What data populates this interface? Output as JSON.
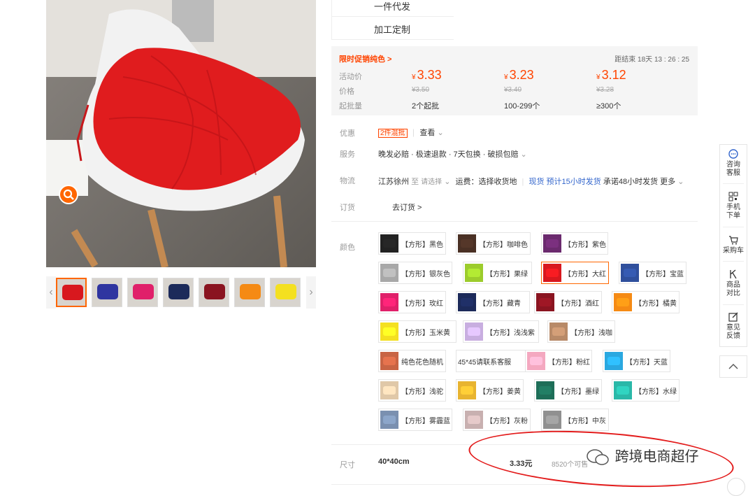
{
  "options": [
    "一件代发",
    "加工定制"
  ],
  "promo": {
    "tag": "限时促销纯色 >",
    "countdown": "距结束 18天 13 : 26 : 25",
    "labels": {
      "price": "活动价",
      "orig": "价格",
      "moq": "起批量"
    },
    "currency": "¥",
    "tiers": [
      {
        "price": "3.33",
        "orig": "¥3.50",
        "qty": "2个起批"
      },
      {
        "price": "3.23",
        "orig": "¥3.40",
        "qty": "100-299个"
      },
      {
        "price": "3.12",
        "orig": "¥3.28",
        "qty": "≥300个"
      }
    ]
  },
  "discount": {
    "label": "优惠",
    "badge": "2件混批",
    "view": "查看"
  },
  "service": {
    "label": "服务",
    "text": "晚发必赔 · 极速退款 · 7天包换 · 破损包赔"
  },
  "logistics": {
    "label": "物流",
    "from": "江苏徐州",
    "to": "至",
    "select": "请选择",
    "fee": "运费：选择收货地",
    "stock": "现货",
    "ship": "预计15小时发货",
    "promise": "承诺48小时发货",
    "more": "更多"
  },
  "order": {
    "label": "订货",
    "link": "去订货 >"
  },
  "color": {
    "label": "颜色",
    "options": [
      {
        "name": "【方形】黑色",
        "c": "#222222"
      },
      {
        "name": "【方形】咖啡色",
        "c": "#4a3024"
      },
      {
        "name": "【方形】紫色",
        "c": "#6b2a6e"
      },
      {
        "name": "【方形】银灰色",
        "c": "#a8a8a8"
      },
      {
        "name": "【方形】果绿",
        "c": "#9ccc2c"
      },
      {
        "name": "【方形】大红",
        "c": "#d8181e"
      },
      {
        "name": "【方形】宝蓝",
        "c": "#2f4f9c"
      },
      {
        "name": "【方形】玫红",
        "c": "#e0206a"
      },
      {
        "name": "【方形】藏青",
        "c": "#1c2a5a"
      },
      {
        "name": "【方形】酒红",
        "c": "#8a1420"
      },
      {
        "name": "【方形】橘黄",
        "c": "#f58a14"
      },
      {
        "name": "【方形】玉米黄",
        "c": "#f4e020"
      },
      {
        "name": "【方形】浅浅紫",
        "c": "#c8aee0"
      },
      {
        "name": "【方形】浅咖",
        "c": "#b88a68"
      },
      {
        "name": "纯色花色随机",
        "c": "#c86444"
      },
      {
        "name": "45*45请联系客服",
        "c": ""
      },
      {
        "name": "【方形】粉红",
        "c": "#f4a8c0"
      },
      {
        "name": "【方形】天蓝",
        "c": "#2aa8e0"
      },
      {
        "name": "【方形】浅驼",
        "c": "#e0c8a8"
      },
      {
        "name": "【方形】姜黄",
        "c": "#e8b430"
      },
      {
        "name": "【方形】墨绿",
        "c": "#1e6e58"
      },
      {
        "name": "【方形】水绿",
        "c": "#2ab8a8"
      },
      {
        "name": "【方形】雾霾蓝",
        "c": "#7a90b0"
      },
      {
        "name": "【方形】灰粉",
        "c": "#c8b0b0"
      },
      {
        "name": "【方形】中灰",
        "c": "#909090"
      }
    ]
  },
  "size": {
    "label": "尺寸",
    "name": "40*40cm",
    "price": "3.33元",
    "stock": "8520个可售"
  },
  "watermark": "跨境电商超仔",
  "thumbs": [
    "#d8181e",
    "#2f35a0",
    "#e0206a",
    "#1c2a5a",
    "#8a1420",
    "#f58a14",
    "#f4e020"
  ],
  "toolbar": [
    {
      "label": "咨询\n客服",
      "icon": "chat-icon"
    },
    {
      "label": "手机\n下单",
      "icon": "qrcode-icon"
    },
    {
      "label": "采购车",
      "icon": "cart-icon"
    },
    {
      "label": "商品\n对比",
      "icon": "compare-icon"
    },
    {
      "label": "意见\n反馈",
      "icon": "feedback-icon"
    }
  ]
}
